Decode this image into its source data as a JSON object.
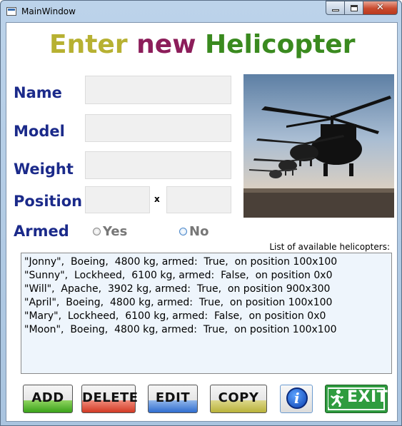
{
  "window": {
    "title": "MainWindow"
  },
  "heading": {
    "word1": "Enter",
    "word2": "new",
    "word3": "Helicopter"
  },
  "form": {
    "name_label": "Name",
    "model_label": "Model",
    "weight_label": "Weight",
    "position_label": "Position",
    "position_separator": "x",
    "armed_label": "Armed",
    "armed_yes": "Yes",
    "armed_no": "No",
    "armed_selected": "No",
    "name_value": "",
    "model_value": "",
    "weight_value": "",
    "position_x_value": "",
    "position_y_value": ""
  },
  "list": {
    "caption": "List of available helicopters:",
    "items": [
      "\"Jonny\",  Boeing,  4800 kg, armed:  True,  on position 100x100",
      "\"Sunny\",  Lockheed,  6100 kg, armed:  False,  on position 0x0",
      "\"Will\",  Apache,  3902 kg, armed:  True,  on position 900x300",
      "\"April\",  Boeing,  4800 kg, armed:  True,  on position 100x100",
      "\"Mary\",  Lockheed,  6100 kg, armed:  False,  on position 0x0",
      "\"Moon\",  Boeing,  4800 kg, armed:  True,  on position 100x100"
    ]
  },
  "buttons": {
    "add": "ADD",
    "delete": "DELETE",
    "edit": "EDIT",
    "copy": "COPY",
    "info": "i",
    "exit": "EXIT"
  },
  "colors": {
    "label_blue": "#1b2a8a",
    "heading_olive": "#b7b132",
    "heading_maroon": "#8c1d5a",
    "heading_green": "#3a8a1f"
  }
}
